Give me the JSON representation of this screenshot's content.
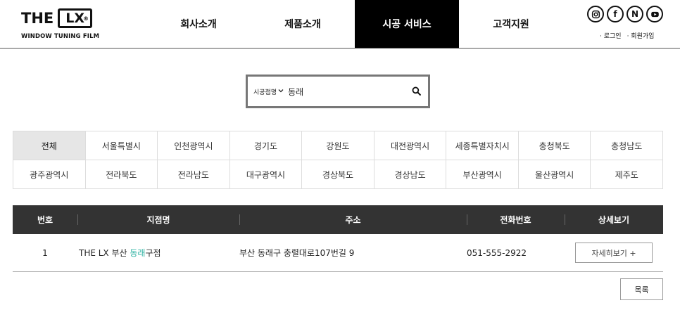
{
  "logo": {
    "the": "THE",
    "lx": "LX",
    "mark": "®",
    "tagline": "WINDOW TUNING FILM"
  },
  "nav": [
    {
      "label": "회사소개"
    },
    {
      "label": "제품소개"
    },
    {
      "label": "시공 서비스",
      "active": true
    },
    {
      "label": "고객지원"
    }
  ],
  "social": {
    "instagram": "instagram-icon",
    "facebook": "f",
    "naver": "N",
    "youtube": "youtube-icon"
  },
  "member": {
    "login": "· 로그인",
    "signup": "· 회원가입"
  },
  "search": {
    "select_label": "시공점명",
    "value": "동래"
  },
  "regions": [
    "전체",
    "서울특별시",
    "인천광역시",
    "경기도",
    "강원도",
    "대전광역시",
    "세종특별자치시",
    "충청북도",
    "충청남도",
    "광주광역시",
    "전라북도",
    "전라남도",
    "대구광역시",
    "경상북도",
    "경상남도",
    "부산광역시",
    "울산광역시",
    "제주도"
  ],
  "active_region": "전체",
  "table": {
    "headers": [
      "번호",
      "지점명",
      "주소",
      "전화번호",
      "상세보기"
    ],
    "rows": [
      {
        "no": "1",
        "name_prefix": "THE LX 부산 ",
        "name_highlight": "동래",
        "name_suffix": "구점",
        "address": "부산 동래구 충렬대로107번길 9",
        "phone": "051-555-2922",
        "detail": "자세히보기 +"
      }
    ]
  },
  "list_button": "목록",
  "colors": {
    "highlight": "#2ab0a0",
    "nav_active_bg": "#000000",
    "table_header_bg": "#333333"
  }
}
